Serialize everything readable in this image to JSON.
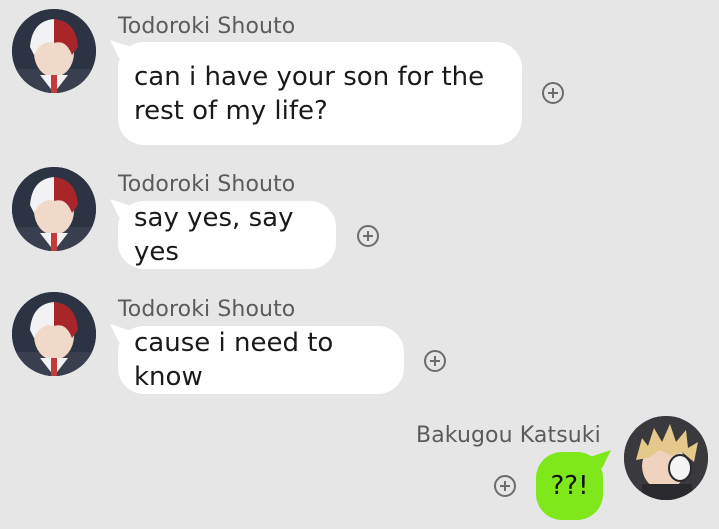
{
  "messages": [
    {
      "sender": "Todoroki Shouto",
      "text": "can i have your son for the rest of my life?",
      "direction": "incoming",
      "avatar_icon": "todoroki-avatar-icon"
    },
    {
      "sender": "Todoroki Shouto",
      "text": "say yes, say yes",
      "direction": "incoming",
      "avatar_icon": "todoroki-avatar-icon"
    },
    {
      "sender": "Todoroki Shouto",
      "text": "cause i need to know",
      "direction": "incoming",
      "avatar_icon": "todoroki-avatar-icon"
    },
    {
      "sender": "Bakugou Katsuki",
      "text": "??!",
      "direction": "outgoing",
      "avatar_icon": "bakugou-avatar-icon"
    }
  ],
  "colors": {
    "background": "#e6e6e6",
    "incoming_bubble": "#ffffff",
    "outgoing_bubble": "#7ee81a",
    "sender_name": "#5b5b5b",
    "icon": "#6c6c6c"
  },
  "icons": {
    "add_reaction": "plus-circle-icon"
  }
}
